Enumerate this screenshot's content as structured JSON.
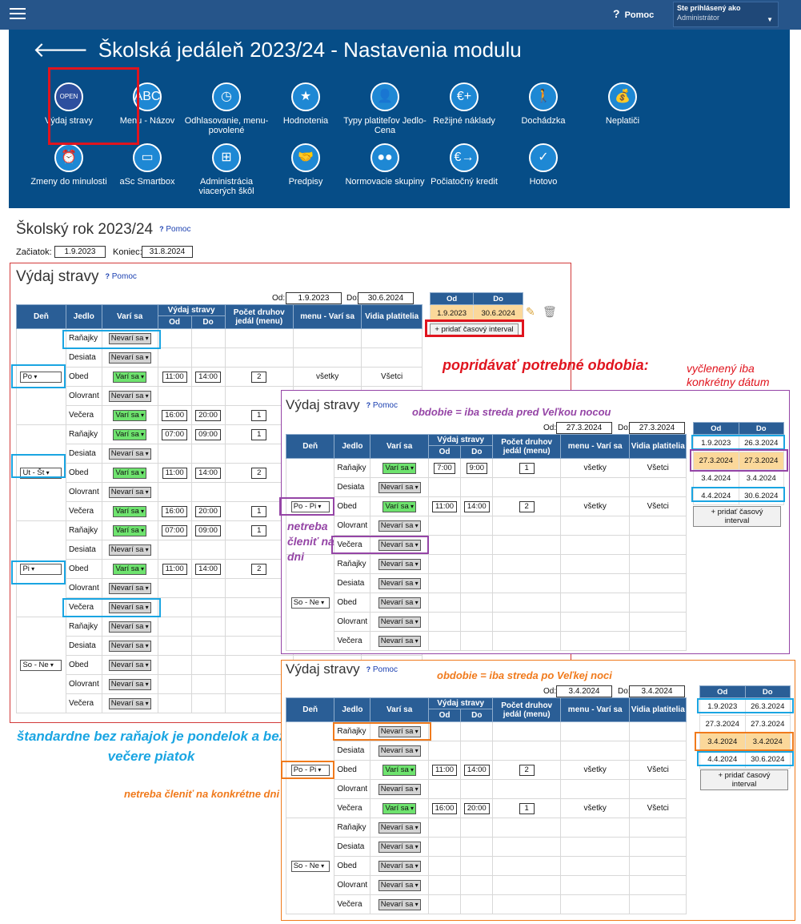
{
  "topbar": {
    "help": "Pomoc",
    "user_label": "Ste prihlásený ako",
    "user_value": "Administrátor"
  },
  "header": {
    "title": "Školská jedáleň 2023/24 - Nastavenia modulu"
  },
  "modules": [
    {
      "label": "Výdaj stravy",
      "icon": "open-sign-icon"
    },
    {
      "label": "Menu - Názov",
      "icon": "abc-123-icon"
    },
    {
      "label": "Odhlasovanie, menu-povolené",
      "icon": "clock-icon"
    },
    {
      "label": "Hodnotenia",
      "icon": "star-icon"
    },
    {
      "label": "Typy platiteľov Jedlo-Cena",
      "icon": "payer-types-icon"
    },
    {
      "label": "Režijné náklady",
      "icon": "euro-plus-icon"
    },
    {
      "label": "Dochádzka",
      "icon": "walking-person-icon"
    },
    {
      "label": "Neplatiči",
      "icon": "money-bag-icon"
    },
    {
      "label": "Zmeny do minulosti",
      "icon": "alarm-clock-icon"
    },
    {
      "label": "aSc Smartbox",
      "icon": "monitor-icon"
    },
    {
      "label": "Administrácia viacerých škôl",
      "icon": "org-chart-icon"
    },
    {
      "label": "Predpisy",
      "icon": "handshake-icon"
    },
    {
      "label": "Normovacie skupiny",
      "icon": "groups-icon"
    },
    {
      "label": "Počiatočný kredit",
      "icon": "euro-arrow-icon"
    },
    {
      "label": "Hotovo",
      "icon": "check-icon"
    }
  ],
  "school_year": {
    "title": "Školský rok 2023/24",
    "help": "Pomoc",
    "start_label": "Začiatok:",
    "start": "1.9.2023",
    "end_label": "Koniec:",
    "end": "31.8.2024"
  },
  "columns": {
    "day": "Deň",
    "meal": "Jedlo",
    "cooked": "Varí sa",
    "serving": "Výdaj stravy",
    "from": "Od",
    "to": "Do",
    "count": "Počet druhov jedál (menu)",
    "menu": "menu - Varí sa",
    "visible": "Vidia platitelia"
  },
  "opts": {
    "yes": "Varí sa",
    "no": "Nevarí sa"
  },
  "meals": [
    "Raňajky",
    "Desiata",
    "Obed",
    "Olovrant",
    "Večera"
  ],
  "main": {
    "title": "Výdaj stravy",
    "help": "Pomoc",
    "od_label": "Od:",
    "od": "1.9.2023",
    "do_label": "Do:",
    "do": "30.6.2024",
    "days": [
      "Po",
      "Ut - Št",
      "Pi",
      "So - Ne"
    ],
    "po": {
      "obed_from": "11:00",
      "obed_to": "14:00",
      "obed_count": "2",
      "obed_menu": "všetky",
      "obed_visible": "Všetci",
      "vec_from": "16:00",
      "vec_to": "20:00",
      "vec_count": "1"
    },
    "ut": {
      "r_from": "07:00",
      "r_to": "09:00",
      "r_count": "1",
      "o_from": "11:00",
      "o_to": "14:00",
      "o_count": "2",
      "v_from": "16:00",
      "v_to": "20:00",
      "v_count": "1"
    },
    "pi": {
      "r_from": "07:00",
      "r_to": "09:00",
      "r_count": "1",
      "o_from": "11:00",
      "o_to": "14:00",
      "o_count": "2"
    },
    "intervals": [
      {
        "od": "1.9.2023",
        "do": "30.6.2024"
      }
    ],
    "add_interval": "+ pridať časový interval"
  },
  "p2": {
    "title": "Výdaj stravy",
    "help": "Pomoc",
    "od": "27.3.2024",
    "do": "27.3.2024",
    "days": [
      "Po - Pi",
      "So - Ne"
    ],
    "r_from": "7:00",
    "r_to": "9:00",
    "r_count": "1",
    "r_menu": "všetky",
    "r_visible": "Všetci",
    "o_from": "11:00",
    "o_to": "14:00",
    "o_count": "2",
    "o_menu": "všetky",
    "o_visible": "Všetci",
    "intervals": [
      {
        "od": "1.9.2023",
        "do": "26.3.2024"
      },
      {
        "od": "27.3.2024",
        "do": "27.3.2024"
      },
      {
        "od": "3.4.2024",
        "do": "3.4.2024"
      },
      {
        "od": "4.4.2024",
        "do": "30.6.2024"
      }
    ]
  },
  "p3": {
    "title": "Výdaj stravy",
    "help": "Pomoc",
    "od": "3.4.2024",
    "do": "3.4.2024",
    "days": [
      "Po - Pi",
      "So - Ne"
    ],
    "o_from": "11:00",
    "o_to": "14:00",
    "o_count": "2",
    "o_menu": "všetky",
    "o_visible": "Všetci",
    "v_from": "16:00",
    "v_to": "20:00",
    "v_count": "1",
    "v_menu": "všetky",
    "v_visible": "Všetci",
    "intervals": [
      {
        "od": "1.9.2023",
        "do": "26.3.2024"
      },
      {
        "od": "27.3.2024",
        "do": "27.3.2024"
      },
      {
        "od": "3.4.2024",
        "do": "3.4.2024"
      },
      {
        "od": "4.4.2024",
        "do": "30.6.2024"
      }
    ]
  },
  "annotations": {
    "a1": "popridávať potrebné obdobia:",
    "a2": "vyčlenený iba konkrétny dátum",
    "a3": "obdobie = iba streda pred Veľkou nocou",
    "a4": "netreba členiť na dni",
    "a5": "obdobie = iba streda po Veľkej noci",
    "a6": "štandardne bez raňajok je pondelok a bez večere piatok",
    "a7": "netreba členiť na konkrétne dni"
  }
}
